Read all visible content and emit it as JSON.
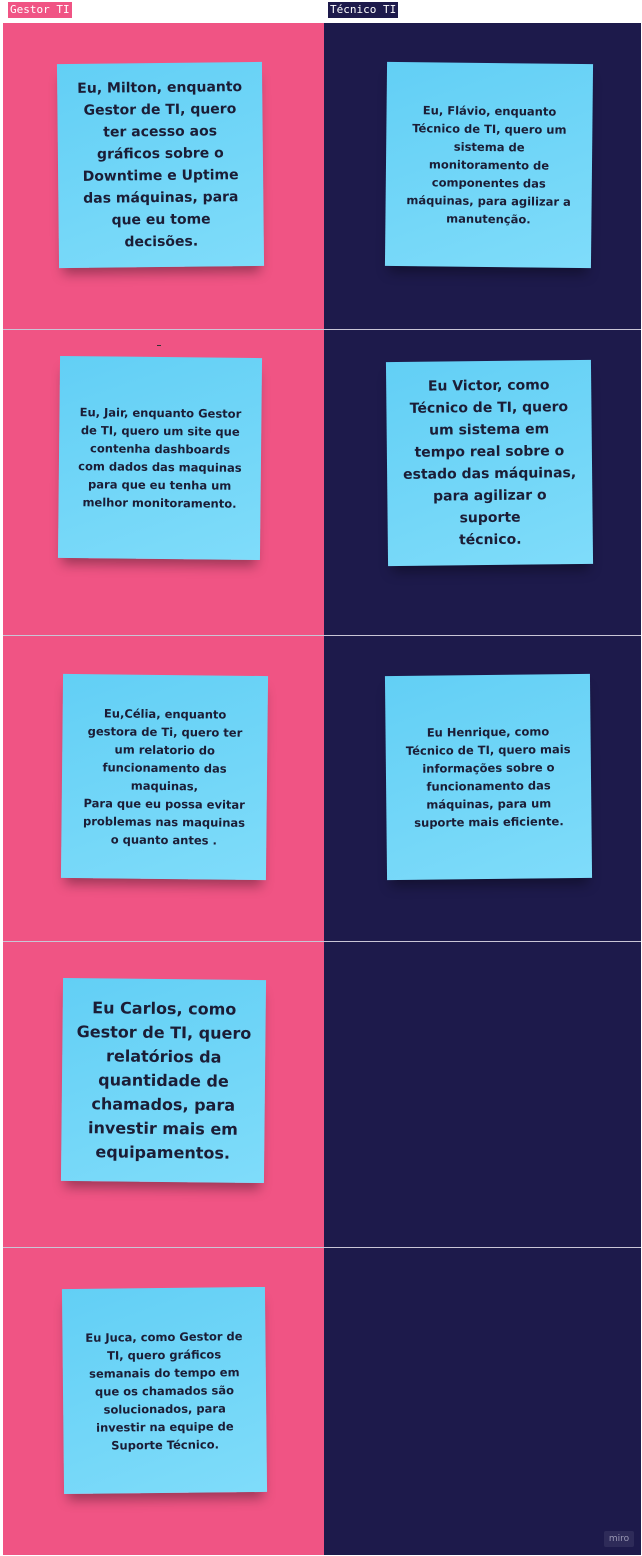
{
  "columns": {
    "left_label": "Gestor TI",
    "right_label": "Técnico TI"
  },
  "stickies": [
    {
      "text": "Eu, Milton, enquanto\nGestor de TI, quero\nter acesso aos\ngráficos sobre o\nDowntime e Uptime\ndas máquinas, para\nque eu tome decisões."
    },
    {
      "text": "Eu, Flávio, enquanto\nTécnico de TI, quero um\nsistema de\nmonitoramento de\ncomponentes das\nmáquinas, para agilizar a\nmanutenção."
    },
    {
      "text": "Eu, Jair, enquanto Gestor\nde TI, quero um site que\ncontenha dashboards\ncom dados das maquinas\npara que eu tenha um\nmelhor monitoramento."
    },
    {
      "text": "Eu Victor, como\nTécnico de TI, quero\num sistema em\ntempo real sobre o\nestado das máquinas,\npara agilizar o suporte\ntécnico."
    },
    {
      "text": "Eu,Célia, enquanto\ngestora de Ti, quero ter\num relatorio do\nfuncionamento das\nmaquinas,\nPara que eu possa evitar\nproblemas nas maquinas\no quanto antes ."
    },
    {
      "text": "Eu Henrique, como\nTécnico de TI, quero mais\ninformações sobre o\nfuncionamento das\nmáquinas, para um\nsuporte mais eficiente."
    },
    {
      "text": "Eu Carlos, como\nGestor de TI, quero\nrelatórios da\nquantidade de\nchamados, para\ninvestir mais em\nequipamentos."
    },
    {
      "text": "Eu Juca, como Gestor de\nTI, quero gráficos\nsemanais do tempo em\nque os chamados são\nsolucionados, para\ninvestir na equipe de\nSuporte Técnico."
    }
  ],
  "watermark": "miro",
  "colors": {
    "gestor": "#f05484",
    "tecnico": "#1d1a4b",
    "sticky": "#6ad4f7"
  }
}
